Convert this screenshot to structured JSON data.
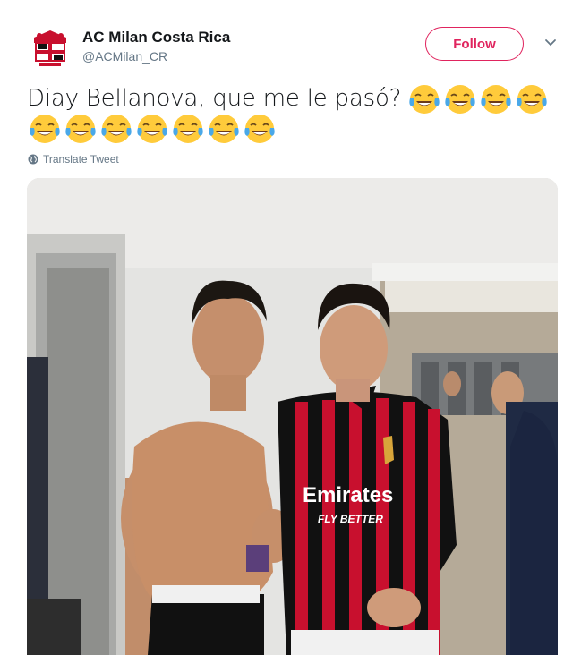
{
  "tweet": {
    "author": {
      "display_name": "AC Milan Costa Rica",
      "handle": "@ACMilan_CR",
      "avatar_icon": "ac-milan-crest-icon"
    },
    "follow_label": "Follow",
    "text": "Diay Bellanova, que me le pasó?",
    "emoji": {
      "name": "face-with-tears-of-joy",
      "count_line1": 4,
      "count_line2": 7
    },
    "translate_label": "Translate Tweet",
    "photo_jersey_text": {
      "sponsor": "Emirates",
      "tagline": "FLY BETTER"
    }
  },
  "colors": {
    "follow_accent": "#e0245e",
    "secondary_text": "#657786",
    "primary_text": "#14171a"
  }
}
